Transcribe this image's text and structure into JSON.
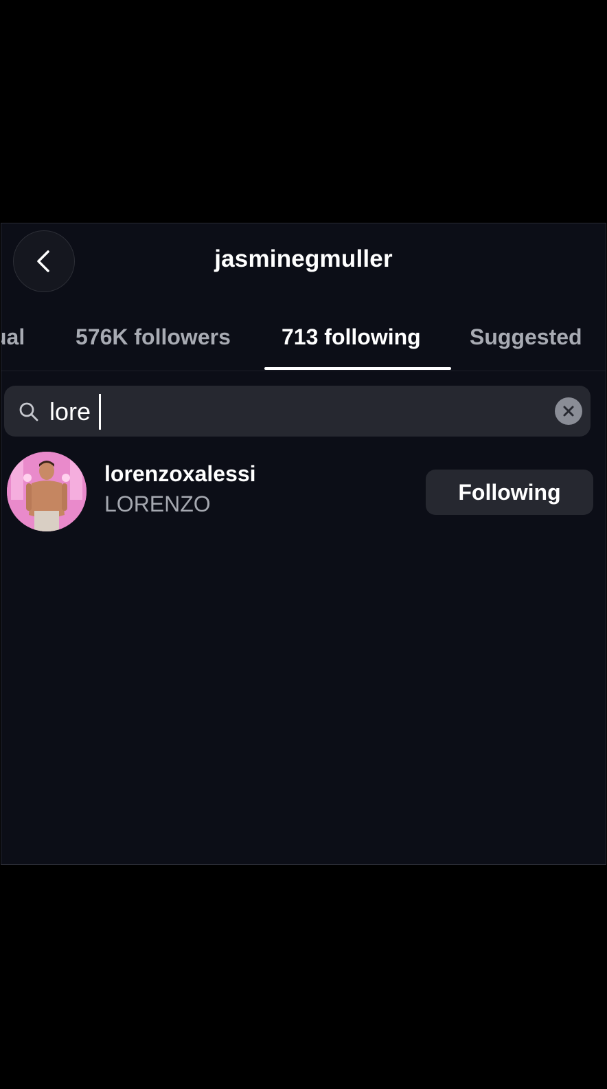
{
  "header": {
    "title": "jasminegmuller",
    "back_icon": "chevron-left-icon"
  },
  "tabs": [
    {
      "label": "ual",
      "active": false
    },
    {
      "label": "576K followers",
      "active": false
    },
    {
      "label": "713 following",
      "active": true
    },
    {
      "label": "Suggested",
      "active": false
    }
  ],
  "search": {
    "value": "lore",
    "icon": "search-icon",
    "clear_icon": "close-icon"
  },
  "results": [
    {
      "username": "lorenzoxalessi",
      "fullname": "LORENZO",
      "button_label": "Following"
    }
  ],
  "colors": {
    "background": "#0c0e17",
    "surface": "#262830",
    "text_primary": "#ffffff",
    "text_secondary": "#a5a8b0",
    "avatar_accent": "#e37ac3"
  }
}
